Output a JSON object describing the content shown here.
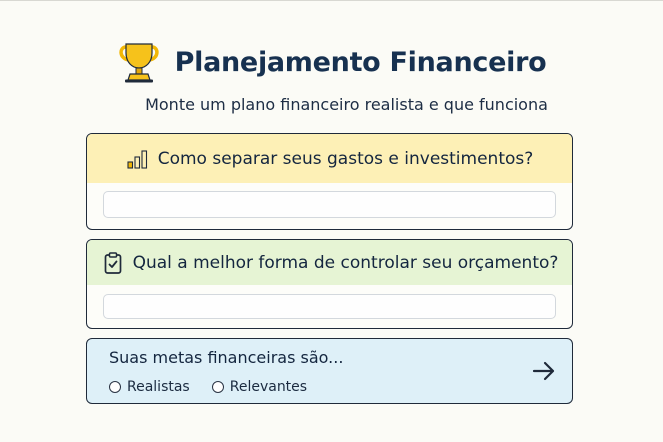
{
  "header": {
    "title": "Planejamento Financeiro",
    "subtitle": "Monte um plano financeiro realista e que funciona",
    "icon": "trophy-icon"
  },
  "questions": [
    {
      "label": "Como separar seus gastos e investimentos?",
      "icon": "bar-chart-icon",
      "answer_value": "",
      "header_color": "#fdf0b6"
    },
    {
      "label": "Qual a melhor forma de controlar seu orçamento?",
      "icon": "clipboard-check-icon",
      "answer_value": "",
      "header_color": "#e6f4d4"
    }
  ],
  "goals": {
    "prompt": "Suas metas financeiras são...",
    "options": [
      "Realistas",
      "Relevantes"
    ],
    "next_icon": "arrow-right-icon",
    "background": "#def0f8"
  },
  "colors": {
    "accent": "#f2b705",
    "text": "#14263f"
  }
}
